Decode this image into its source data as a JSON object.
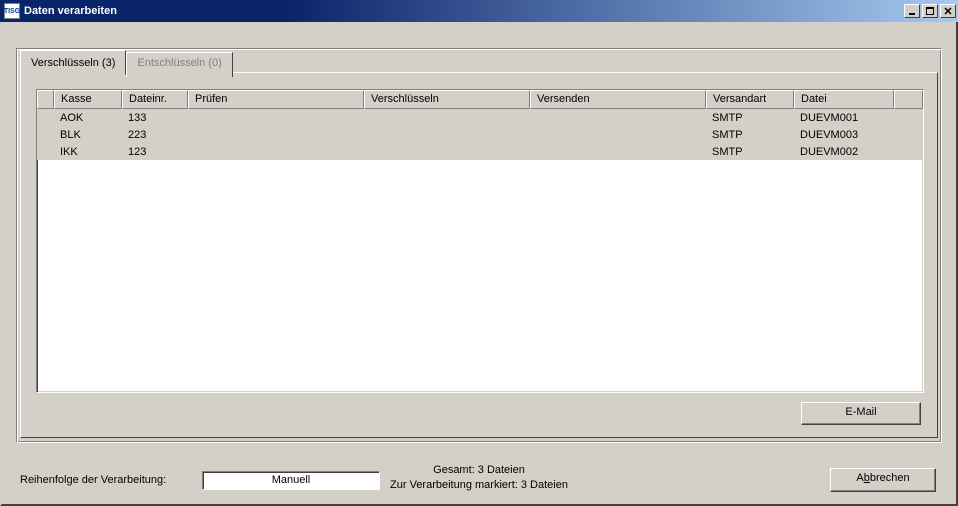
{
  "window": {
    "app_icon_text": "TISG",
    "title": "Daten verarbeiten"
  },
  "tabs": {
    "active_label": "Verschlüsseln (3)",
    "inactive_label": "Entschlüsseln (0)"
  },
  "columns": {
    "kasse": "Kasse",
    "dateinr": "Dateinr.",
    "pruefen": "Prüfen",
    "verschluesseln": "Verschlüsseln",
    "versenden": "Versenden",
    "versandart": "Versandart",
    "datei": "Datei"
  },
  "rows": [
    {
      "kasse": "AOK",
      "dateinr": "133",
      "pruefen": "",
      "verschluesseln": "",
      "versenden": "",
      "versandart": "SMTP",
      "datei": "DUEVM001"
    },
    {
      "kasse": "BLK",
      "dateinr": "223",
      "pruefen": "",
      "verschluesseln": "",
      "versenden": "",
      "versandart": "SMTP",
      "datei": "DUEVM003"
    },
    {
      "kasse": "IKK",
      "dateinr": "123",
      "pruefen": "",
      "verschluesseln": "",
      "versenden": "",
      "versandart": "SMTP",
      "datei": "DUEVM002"
    }
  ],
  "buttons": {
    "email": "E-Mail",
    "cancel_pre": "A",
    "cancel_u": "b",
    "cancel_post": "brechen"
  },
  "footer": {
    "order_label": "Reihenfolge der Verarbeitung:",
    "order_value": "Manuell",
    "total": "Gesamt: 3 Dateien",
    "marked": "Zur Verarbeitung markiert: 3 Dateien"
  }
}
